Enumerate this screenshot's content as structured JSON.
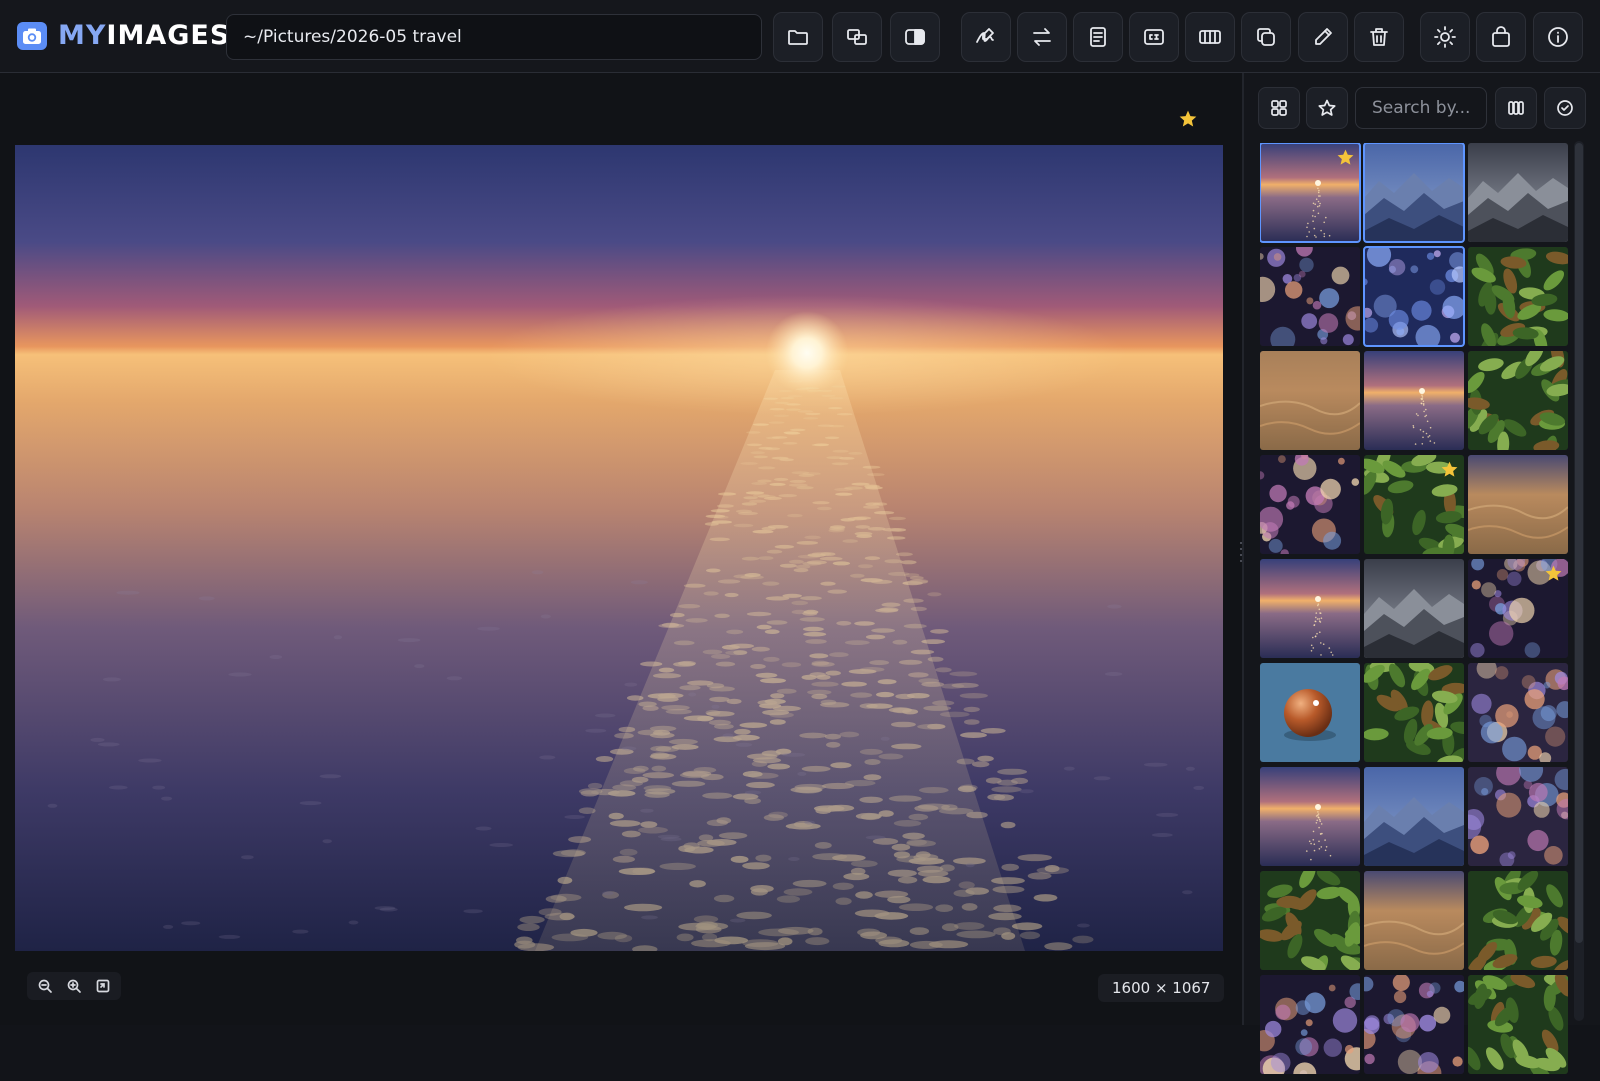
{
  "app": {
    "brand_a": "MY",
    "brand_b": "IMAGES",
    "icon": "camera-icon"
  },
  "toolbar": {
    "path_value": "~/Pictures/2026-05 travel",
    "buttons": [
      {
        "name": "open-folder-button",
        "icon": "folder-icon"
      },
      {
        "name": "compare-button",
        "icon": "compare-icon"
      },
      {
        "name": "split-view-button",
        "icon": "contrast-icon"
      },
      {
        "name": "annotate-button",
        "icon": "signature-icon"
      },
      {
        "name": "swap-button",
        "icon": "swap-arrows-icon"
      },
      {
        "name": "details-button",
        "icon": "document-icon"
      },
      {
        "name": "caption-button",
        "icon": "caption-icon"
      },
      {
        "name": "filmstrip-button",
        "icon": "filmstrip-icon"
      },
      {
        "name": "duplicate-button",
        "icon": "copy-icon"
      },
      {
        "name": "edit-button",
        "icon": "pencil-icon"
      },
      {
        "name": "delete-button",
        "icon": "trash-icon"
      },
      {
        "name": "theme-button",
        "icon": "sun-icon"
      },
      {
        "name": "bag-button",
        "icon": "bag-icon"
      },
      {
        "name": "info-button",
        "icon": "info-icon"
      }
    ]
  },
  "viewer": {
    "favorite": true,
    "dimensions": "1600 × 1067",
    "image": "sunset-over-sea",
    "zoom_controls": [
      "zoom-out-icon",
      "zoom-in-icon",
      "fit-screen-icon"
    ]
  },
  "sidebar": {
    "search_placeholder": "Search by...",
    "buttons": [
      "grid-icon",
      "star-icon",
      "columns-icon",
      "check-circle-icon"
    ],
    "thumbnails": [
      {
        "kind": "sunset",
        "selected": true,
        "favorite": true
      },
      {
        "kind": "mountains-blue",
        "selected": true,
        "favorite": false
      },
      {
        "kind": "mountains-gray",
        "selected": false,
        "favorite": false
      },
      {
        "kind": "bokeh-warm",
        "selected": false,
        "favorite": false
      },
      {
        "kind": "bokeh-blue",
        "selected": true,
        "favorite": false
      },
      {
        "kind": "leaves",
        "selected": false,
        "favorite": false
      },
      {
        "kind": "dunes",
        "selected": false,
        "favorite": false
      },
      {
        "kind": "sunset",
        "selected": false,
        "favorite": false
      },
      {
        "kind": "leaves",
        "selected": false,
        "favorite": false
      },
      {
        "kind": "bokeh-warm",
        "selected": false,
        "favorite": false
      },
      {
        "kind": "leaves",
        "selected": false,
        "favorite": true
      },
      {
        "kind": "dunes-dusk",
        "selected": false,
        "favorite": false
      },
      {
        "kind": "sunset",
        "selected": false,
        "favorite": false
      },
      {
        "kind": "mountains-gray",
        "selected": false,
        "favorite": false
      },
      {
        "kind": "bokeh-warm",
        "selected": false,
        "favorite": true
      },
      {
        "kind": "sphere",
        "selected": false,
        "favorite": false
      },
      {
        "kind": "leaves",
        "selected": false,
        "favorite": false
      },
      {
        "kind": "bokeh-pale",
        "selected": false,
        "favorite": false
      },
      {
        "kind": "sunset",
        "selected": false,
        "favorite": false
      },
      {
        "kind": "mountains-blue",
        "selected": false,
        "favorite": false
      },
      {
        "kind": "bokeh-pale",
        "selected": false,
        "favorite": false
      },
      {
        "kind": "leaves",
        "selected": false,
        "favorite": false
      },
      {
        "kind": "dunes-dusk",
        "selected": false,
        "favorite": false
      },
      {
        "kind": "leaves",
        "selected": false,
        "favorite": false
      },
      {
        "kind": "bokeh-warm",
        "selected": false,
        "favorite": false
      },
      {
        "kind": "bokeh-warm",
        "selected": false,
        "favorite": false
      },
      {
        "kind": "leaves",
        "selected": false,
        "favorite": false
      }
    ]
  },
  "colors": {
    "accent": "#5e95ff",
    "star": "#f4c43a",
    "background": "#121419"
  }
}
